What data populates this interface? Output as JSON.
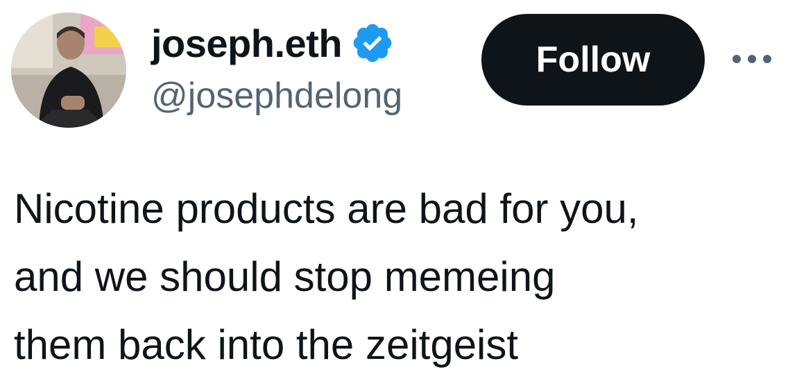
{
  "author": {
    "display_name": "joseph.eth",
    "handle": "@josephdelong",
    "verified": true,
    "verified_color": "#1d9bf0"
  },
  "actions": {
    "follow_label": "Follow",
    "more_icon": "ellipsis-icon"
  },
  "tweet": {
    "lines": [
      "Nicotine products are bad for you,",
      "and we should stop memeing",
      "them back into the zeitgeist"
    ]
  },
  "colors": {
    "text": "#0f1419",
    "secondary_text": "#536471",
    "button_bg": "#0f1419",
    "button_text": "#ffffff"
  }
}
